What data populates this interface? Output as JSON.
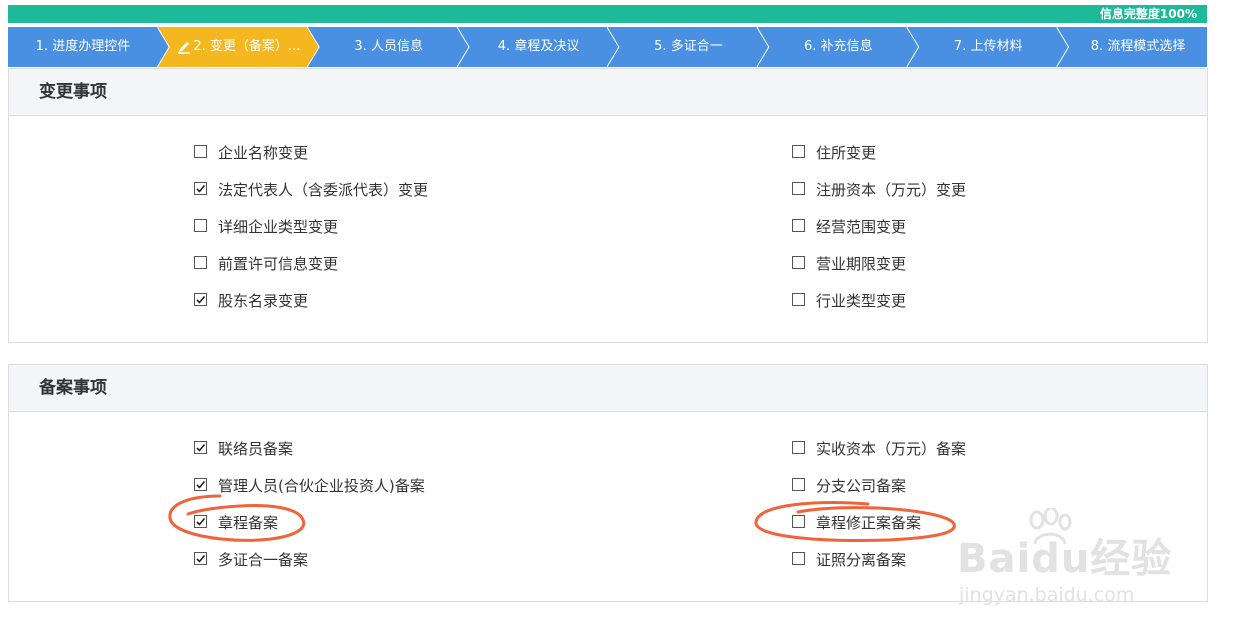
{
  "progress": {
    "text": "信息完整度100%",
    "percent": 100,
    "color": "#1db998"
  },
  "steps": [
    {
      "label": "1. 进度办理控件",
      "state": "done"
    },
    {
      "label": "2. 变更（备案）...",
      "state": "current",
      "icon": "pen-icon"
    },
    {
      "label": "3. 人员信息",
      "state": "pending"
    },
    {
      "label": "4. 章程及决议",
      "state": "pending"
    },
    {
      "label": "5. 多证合一",
      "state": "pending"
    },
    {
      "label": "6. 补充信息",
      "state": "pending"
    },
    {
      "label": "7. 上传材料",
      "state": "pending"
    },
    {
      "label": "8. 流程模式选择",
      "state": "pending"
    }
  ],
  "colors": {
    "step_blue": "#4a90e2",
    "step_current": "#f5b71f",
    "annotation": "#f0643c"
  },
  "change_section": {
    "title": "变更事项",
    "left": [
      {
        "label": "企业名称变更",
        "checked": false
      },
      {
        "label": "法定代表人（含委派代表）变更",
        "checked": true
      },
      {
        "label": "详细企业类型变更",
        "checked": false
      },
      {
        "label": "前置许可信息变更",
        "checked": false
      },
      {
        "label": "股东名录变更",
        "checked": true
      }
    ],
    "right": [
      {
        "label": "住所变更",
        "checked": false
      },
      {
        "label": "注册资本（万元）变更",
        "checked": false
      },
      {
        "label": "经营范围变更",
        "checked": false
      },
      {
        "label": "营业期限变更",
        "checked": false
      },
      {
        "label": "行业类型变更",
        "checked": false
      }
    ]
  },
  "record_section": {
    "title": "备案事项",
    "left": [
      {
        "label": "联络员备案",
        "checked": true
      },
      {
        "label": "管理人员(合伙企业投资人)备案",
        "checked": true
      },
      {
        "label": "章程备案",
        "checked": true
      },
      {
        "label": "多证合一备案",
        "checked": true
      }
    ],
    "right": [
      {
        "label": "实收资本（万元）备案",
        "checked": false
      },
      {
        "label": "分支公司备案",
        "checked": false
      },
      {
        "label": "章程修正案备案",
        "checked": false
      },
      {
        "label": "证照分离备案",
        "checked": false
      }
    ]
  },
  "watermark": {
    "main": "Baidu经验",
    "sub": "jingyan.baidu.com"
  }
}
